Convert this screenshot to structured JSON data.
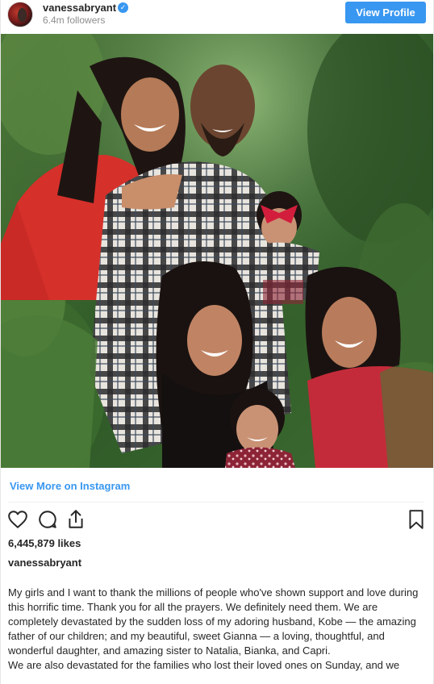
{
  "header": {
    "username": "vanessabryant",
    "followers": "6.4m followers",
    "view_profile_label": "View Profile"
  },
  "post": {
    "view_more_label": "View More on Instagram",
    "likes": "6,445,879 likes",
    "caption_username": "vanessabryant",
    "caption_paragraphs": [
      "My girls and I want to thank the millions of people who've shown support and love during this horrific time. Thank you for all the prayers. We definitely need them. We are completely devastated by the sudden loss of my adoring husband, Kobe — the amazing father of our children; and my beautiful, sweet Gianna — a loving, thoughtful, and wonderful daughter, and amazing sister to Natalia, Bianka, and Capri.",
      "We are also devastated for the families who lost their loved ones on Sunday, and we"
    ]
  },
  "icons": {
    "verified": "verified-badge-icon",
    "like": "heart-icon",
    "comment": "comment-icon",
    "share": "share-icon",
    "save": "bookmark-icon"
  },
  "colors": {
    "accent": "#3897f0",
    "text": "#262626",
    "muted": "#8e8e8e"
  }
}
